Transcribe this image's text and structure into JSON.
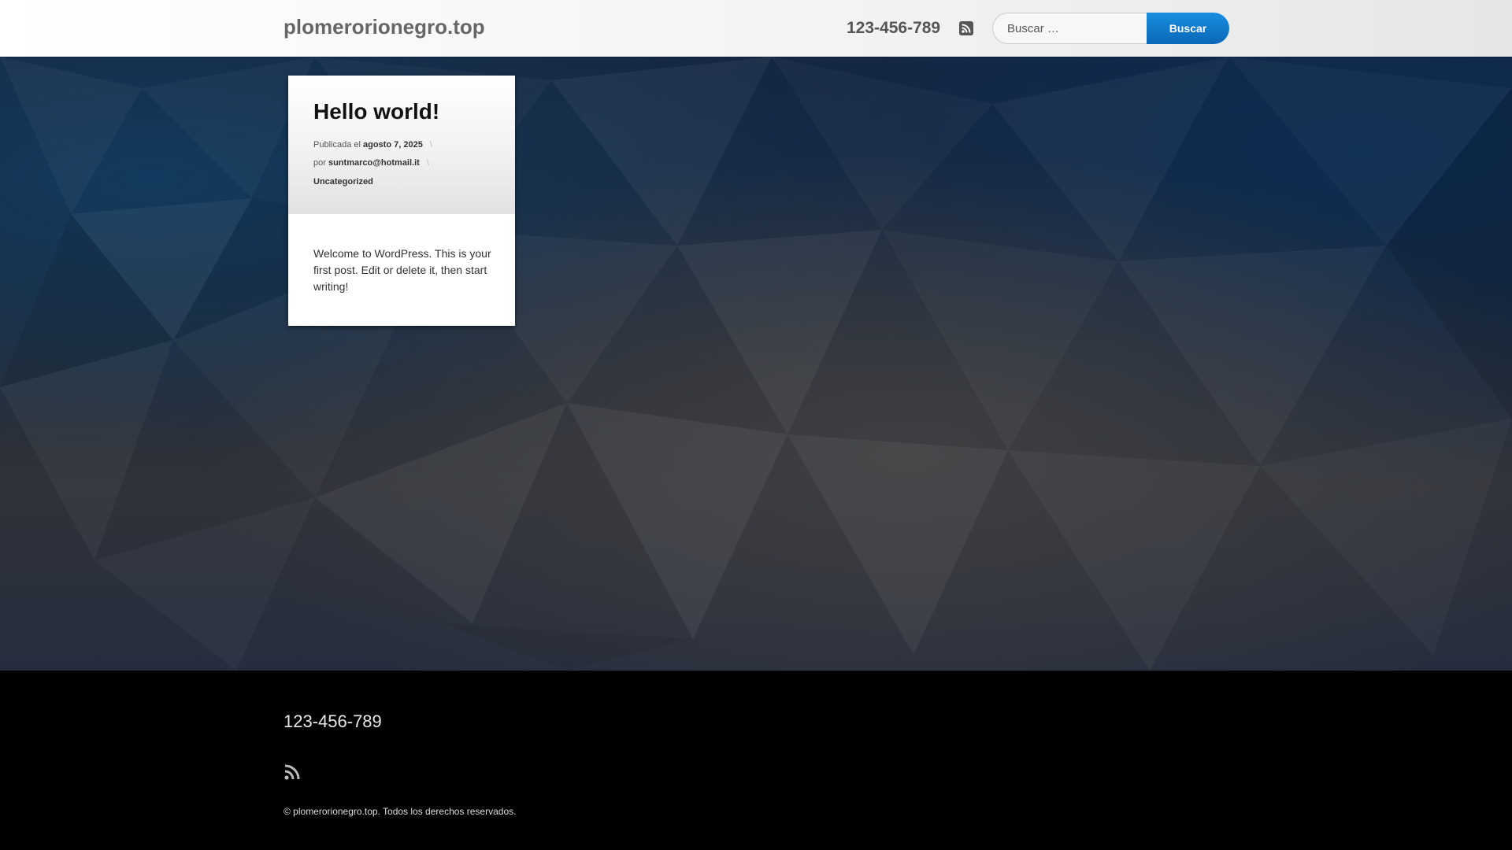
{
  "header": {
    "site_title": "plomerorionegro.top",
    "phone": "123-456-789",
    "rss_icon": "rss-icon",
    "search": {
      "placeholder": "Buscar …",
      "button_label": "Buscar"
    }
  },
  "post": {
    "title": "Hello world!",
    "published_prefix": "Publicada el",
    "date": "agosto 7, 2025",
    "separator": "\\",
    "author_prefix": "por",
    "author": "suntmarco@hotmail.it",
    "category": "Uncategorized",
    "excerpt": "Welcome to WordPress. This is your first post. Edit or delete it, then start writing!"
  },
  "footer": {
    "phone": "123-456-789",
    "rss_icon": "rss-icon",
    "copyright": "© plomerorionegro.top. Todos los derechos reservados."
  },
  "colors": {
    "accent": "#0a67b8",
    "footer_bg": "#000000"
  }
}
